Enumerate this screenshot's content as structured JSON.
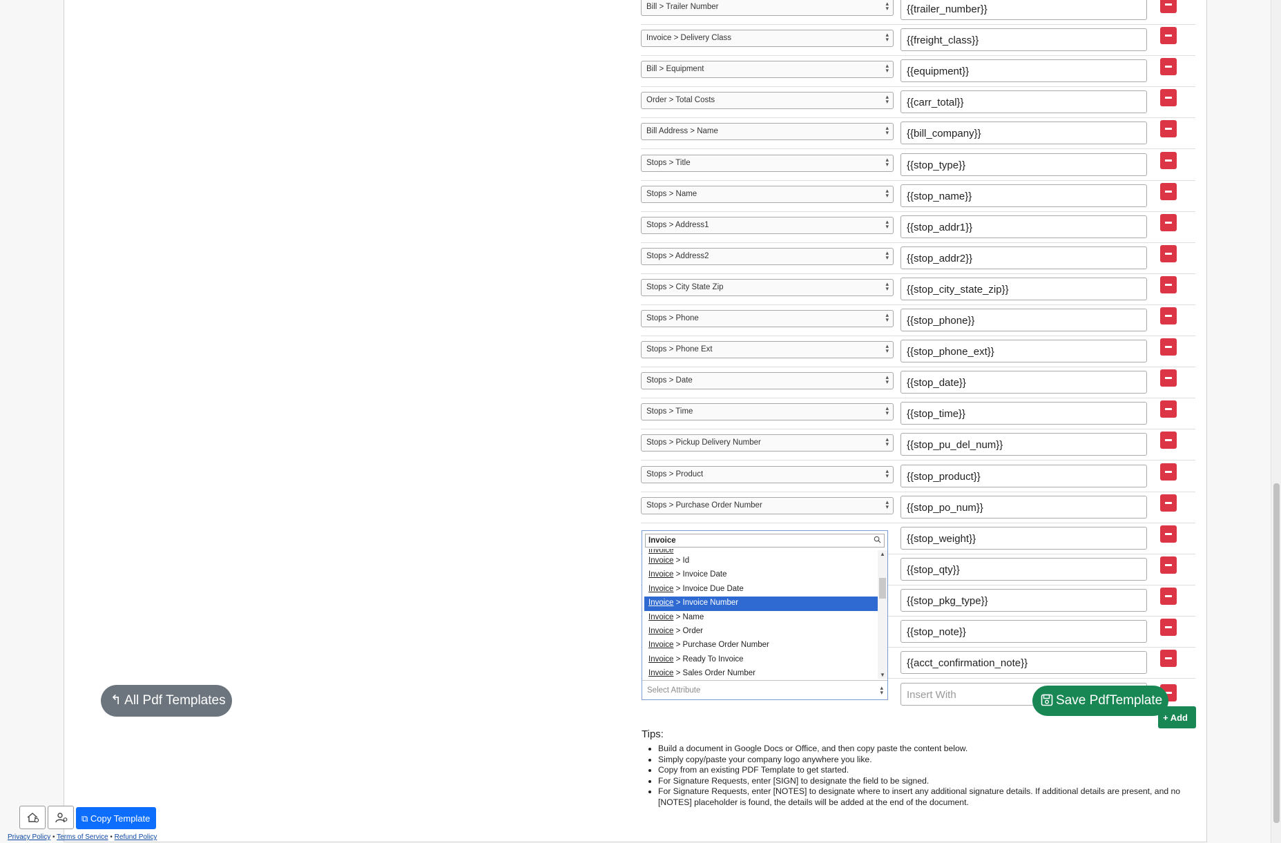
{
  "mapping_rows": [
    {
      "attribute": "Bill > Trailer Number",
      "token": "{{trailer_number}}"
    },
    {
      "attribute": "Invoice > Delivery Class",
      "token": "{{freight_class}}"
    },
    {
      "attribute": "Bill > Equipment",
      "token": "{{equipment}}"
    },
    {
      "attribute": "Order > Total Costs",
      "token": "{{carr_total}}"
    },
    {
      "attribute": "Bill Address > Name",
      "token": "{{bill_company}}"
    },
    {
      "attribute": "Stops > Title",
      "token": "{{stop_type}}"
    },
    {
      "attribute": "Stops > Name",
      "token": "{{stop_name}}"
    },
    {
      "attribute": "Stops > Address1",
      "token": "{{stop_addr1}}"
    },
    {
      "attribute": "Stops > Address2",
      "token": "{{stop_addr2}}"
    },
    {
      "attribute": "Stops > City State Zip",
      "token": "{{stop_city_state_zip}}"
    },
    {
      "attribute": "Stops > Phone",
      "token": "{{stop_phone}}"
    },
    {
      "attribute": "Stops > Phone Ext",
      "token": "{{stop_phone_ext}}"
    },
    {
      "attribute": "Stops > Date",
      "token": "{{stop_date}}"
    },
    {
      "attribute": "Stops > Time",
      "token": "{{stop_time}}"
    },
    {
      "attribute": "Stops > Pickup Delivery Number",
      "token": "{{stop_pu_del_num}}"
    },
    {
      "attribute": "Stops > Product",
      "token": "{{stop_product}}"
    },
    {
      "attribute": "Stops > Purchase Order Number",
      "token": "{{stop_po_num}}"
    },
    {
      "attribute": "",
      "token": "{{stop_weight}}"
    },
    {
      "attribute": "",
      "token": "{{stop_qty}}"
    },
    {
      "attribute": "",
      "token": "{{stop_pkg_type}}"
    },
    {
      "attribute": "",
      "token": "{{stop_note}}"
    },
    {
      "attribute": "",
      "token": "{{acct_confirmation_note}}"
    }
  ],
  "dropdown": {
    "search_value": "Invoice",
    "match": "Invoice",
    "items": [
      " > Id",
      " > Invoice Date",
      " > Invoice Due Date",
      " > Invoice Number",
      " > Name",
      " > Order",
      " > Purchase Order Number",
      " > Ready To Invoice",
      " > Sales Order Number"
    ],
    "active_index": 3,
    "footer_placeholder": "Select Attribute"
  },
  "insert_with_placeholder": "Insert With",
  "buttons": {
    "add": "+ Add",
    "save": "Save PdfTemplate",
    "all_templates": "All Pdf Templates",
    "copy": "Copy Template"
  },
  "tips": {
    "title": "Tips:",
    "items": [
      "Build a document in Google Docs or Office, and then copy paste the content below.",
      "Simply copy/paste your company logo anywhere you like.",
      "Copy from an existing PDF Template to get started.",
      "For Signature Requests, enter [SIGN] to designate the field to be signed.",
      "For Signature Requests, enter [NOTES] to designate where to insert any additional signature details. If additional details are present, and no [NOTES] placeholder is found, the details will be added at the end of the document."
    ]
  },
  "footer": {
    "privacy": "Privacy Policy",
    "sep1": " • ",
    "terms": "Terms of Service",
    "sep2": " • ",
    "refund": "Refund Policy"
  },
  "colors": {
    "remove": "#dc3545",
    "save": "#198754",
    "secondary": "#6c757d",
    "primary": "#0d6efd",
    "highlight": "#2f6ad2"
  }
}
